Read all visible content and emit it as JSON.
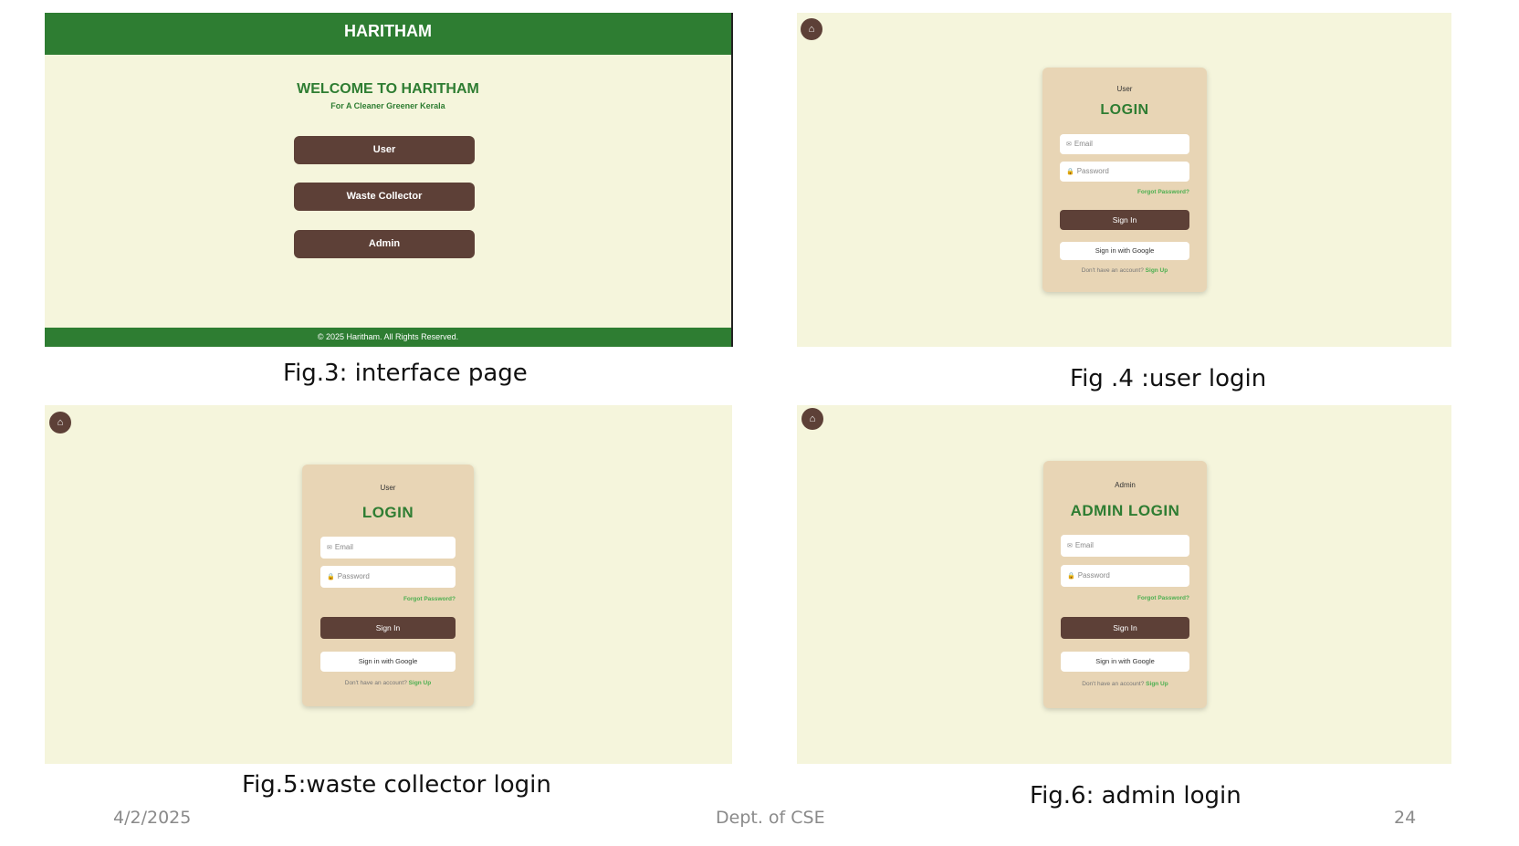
{
  "interface": {
    "header_title": "HARITHAM",
    "welcome": "WELCOME TO HARITHAM",
    "tagline": "For A Cleaner Greener Kerala",
    "buttons": [
      "User",
      "Waste Collector",
      "Admin"
    ],
    "footer": "© 2025 Haritham. All Rights Reserved."
  },
  "user_login": {
    "img_alt": "User",
    "title": "LOGIN",
    "email_placeholder": "Email",
    "password_placeholder": "Password",
    "forgot": "Forgot Password?",
    "signin": "Sign In",
    "google": "Sign in with Google",
    "signup_prompt": "Don't have an account?",
    "signup_link": "Sign Up"
  },
  "collector_login": {
    "img_alt": "User",
    "title": "LOGIN",
    "email_placeholder": "Email",
    "password_placeholder": "Password",
    "forgot": "Forgot Password?",
    "signin": "Sign In",
    "google": "Sign in with Google",
    "signup_prompt": "Don't have an account?",
    "signup_link": "Sign Up"
  },
  "admin_login": {
    "img_alt": "Admin",
    "title": "ADMIN LOGIN",
    "email_placeholder": "Email",
    "password_placeholder": "Password",
    "forgot": "Forgot Password?",
    "signin": "Sign In",
    "google": "Sign in with Google",
    "signup_prompt": "Don't have an account?",
    "signup_link": "Sign Up"
  },
  "captions": {
    "fig3": "Fig.3: interface page",
    "fig4": "Fig .4 :user login",
    "fig5": "Fig.5:waste collector login",
    "fig6": "Fig.6: admin login"
  },
  "slide_footer": {
    "date": "4/2/2025",
    "dept": "Dept. of CSE",
    "page": "24"
  },
  "icons": {
    "home": "home-icon",
    "email": "email-icon",
    "password": "lock-icon"
  },
  "colors": {
    "brand_green": "#2e7d32",
    "button_brown": "#5d4037",
    "page_bg": "#f5f5dc",
    "card_bg": "#e8d5b5",
    "link_green": "#4caf50"
  }
}
